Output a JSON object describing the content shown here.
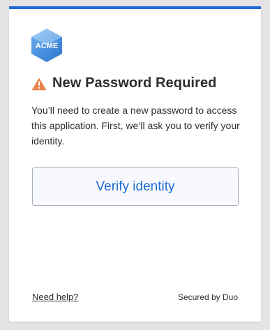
{
  "logo": {
    "text": "ACME",
    "icon": "acme-hexagon-logo"
  },
  "prompt": {
    "icon": "warning-triangle-icon",
    "title": "New Password Required",
    "description": "You’ll need to create a new password to access this application. First, we’ll ask you to verify your identity."
  },
  "actions": {
    "verify_label": "Verify identity"
  },
  "footer": {
    "help_label": "Need help?",
    "secured_label": "Secured by Duo"
  },
  "colors": {
    "accent": "#1f6ad4",
    "warning": "#e8834b",
    "text": "#2b2d30",
    "button_bg": "#f7f9fc"
  }
}
